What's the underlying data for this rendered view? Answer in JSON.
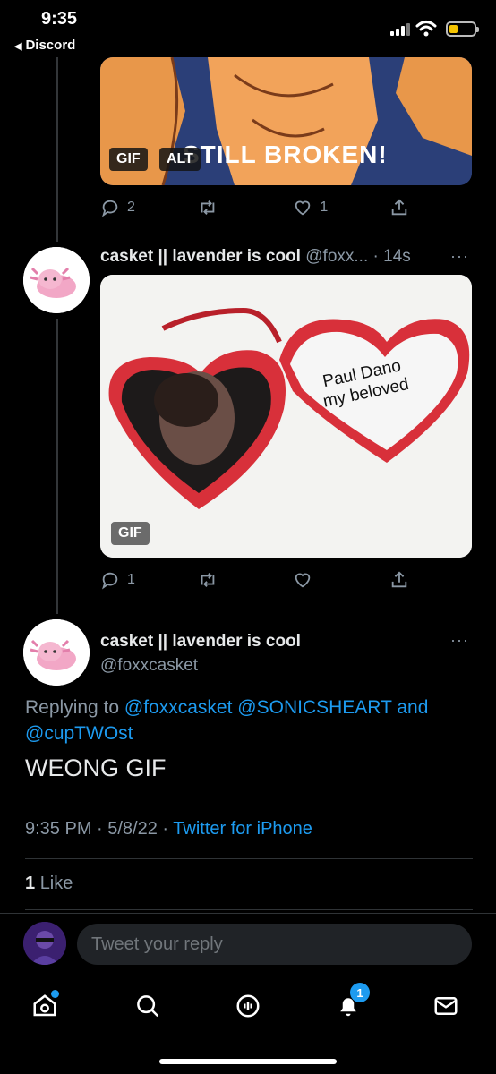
{
  "status_bar": {
    "time": "9:35",
    "back_app": "Discord"
  },
  "tweet_gif1": {
    "caption": "STILL BROKEN!",
    "gif_badge": "GIF",
    "alt_badge": "ALT",
    "actions": {
      "replies": "2",
      "retweets": "",
      "likes": "1"
    }
  },
  "tweet_gif2": {
    "name": "casket || lavender is cool",
    "handle": "@foxx...",
    "time": "· 14s",
    "more": "···",
    "image_text_line1": "Paul Dano",
    "image_text_line2": "my beloved",
    "gif_badge": "GIF",
    "actions": {
      "replies": "1",
      "retweets": "",
      "likes": ""
    }
  },
  "main_tweet": {
    "name": "casket || lavender is cool",
    "handle": "@foxxcasket",
    "more": "···",
    "replying_prefix": "Replying to",
    "reply_mention1": "@foxxcasket",
    "reply_mention2": "@SONICSHEART",
    "reply_and": "and",
    "reply_mention3": "@cupTWOst",
    "text": "WEONG GIF",
    "timestamp": "9:35 PM · 5/8/22 ·",
    "source": "Twitter for iPhone",
    "like_count": "1",
    "like_label": "Like"
  },
  "reply_bar": {
    "placeholder": "Tweet your reply"
  },
  "tab_bar": {
    "notification_count": "1"
  },
  "colors": {
    "accent": "#1d9bf0",
    "background": "#000000",
    "muted": "#8b98a5"
  }
}
